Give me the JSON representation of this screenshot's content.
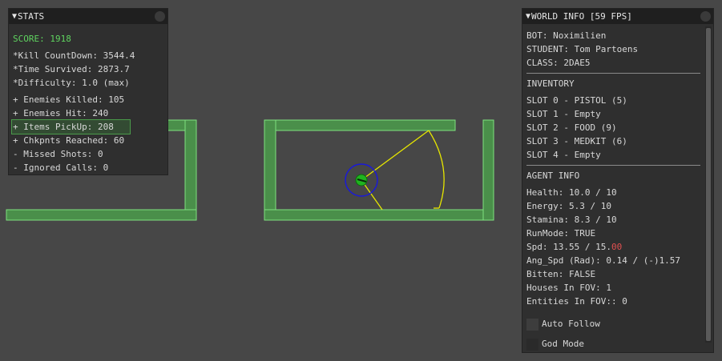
{
  "stats": {
    "title": "STATS",
    "score": "SCORE: 1918",
    "lines_a": [
      "*Kill CountDown: 3544.4",
      "*Time Survived: 2873.7",
      "*Difficulty: 1.0 (max)"
    ],
    "lines_b": [
      "+ Enemies Killed: 105",
      "+ Enemies Hit: 240",
      "+ Items PickUp: 208",
      "+ Chkpnts Reached: 60",
      "- Missed Shots: 0",
      "- Ignored Calls: 0"
    ]
  },
  "world_info": {
    "title": "WORLD INFO [59 FPS]",
    "bot": "BOT: Noximilien",
    "student": "STUDENT: Tom Partoens",
    "class": "CLASS: 2DAE5",
    "inventory_header": "INVENTORY",
    "slots": [
      "SLOT 0 - PISTOL (5)",
      "SLOT 1 - Empty",
      "SLOT 2 - FOOD (9)",
      "SLOT 3 - MEDKIT (6)",
      "SLOT 4 - Empty"
    ],
    "agent_header": "AGENT INFO",
    "health": "Health: 10.0 / 10",
    "energy": "Energy: 5.3 / 10",
    "stamina": "Stamina: 8.3 / 10",
    "runmode": "RunMode: TRUE",
    "spd_prefix": "Spd: 13.55 / 15.",
    "spd_suffix": "00",
    "ang_spd": "Ang_Spd (Rad): 0.14 / (-)1.57",
    "bitten": "Bitten: FALSE",
    "houses": "Houses In FOV: 1",
    "entities": "Entities In FOV:: 0",
    "auto_follow": "Auto Follow",
    "god_mode": "God Mode"
  },
  "colors": {
    "background": "#474747",
    "wall_fill": "#58a858",
    "wall_edge": "#7fe07f",
    "fov_cone": "#e6e600",
    "agent_circle": "#1a1ad8",
    "agent_body": "#1fb41f",
    "score": "#5fd35f"
  }
}
